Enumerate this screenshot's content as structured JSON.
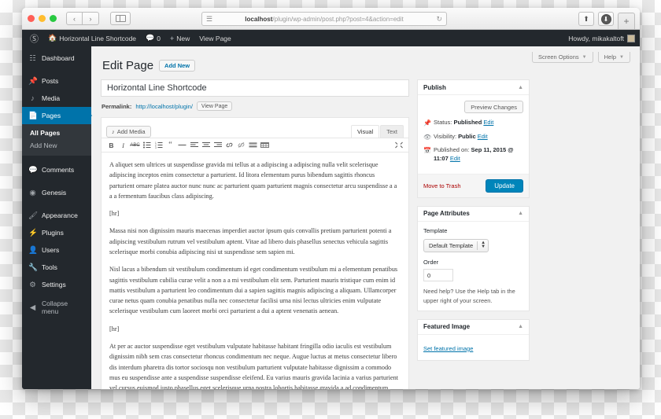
{
  "browser": {
    "url_host": "localhost",
    "url_path": "/plugin/wp-admin/post.php?post=4&action=edit",
    "back_icon": "‹",
    "forward_icon": "›",
    "reader_icon": "☰",
    "reload_icon": "↻",
    "share_icon": "⬆",
    "download_icon": "⬇",
    "newtab_icon": "+"
  },
  "adminbar": {
    "wp_logo": "wordpress-logo",
    "site_name": "Horizontal Line Shortcode",
    "comments_count": "0",
    "new_label": "New",
    "view_page_label": "View Page",
    "howdy": "Howdy, mikakaltoft"
  },
  "sidebar": {
    "items": [
      {
        "label": "Dashboard",
        "icon": "dashboard-icon",
        "current": false
      },
      {
        "label": "Posts",
        "icon": "pin-icon",
        "current": false
      },
      {
        "label": "Media",
        "icon": "media-icon",
        "current": false
      },
      {
        "label": "Pages",
        "icon": "page-icon",
        "current": true
      },
      {
        "label": "Comments",
        "icon": "comment-icon",
        "current": false
      },
      {
        "label": "Genesis",
        "icon": "genesis-icon",
        "current": false
      },
      {
        "label": "Appearance",
        "icon": "brush-icon",
        "current": false
      },
      {
        "label": "Plugins",
        "icon": "plug-icon",
        "current": false
      },
      {
        "label": "Users",
        "icon": "user-icon",
        "current": false
      },
      {
        "label": "Tools",
        "icon": "wrench-icon",
        "current": false
      },
      {
        "label": "Settings",
        "icon": "settings-icon",
        "current": false
      },
      {
        "label": "Collapse menu",
        "icon": "collapse-icon",
        "current": false
      }
    ],
    "submenu": [
      {
        "label": "All Pages",
        "current": true
      },
      {
        "label": "Add New",
        "current": false
      }
    ]
  },
  "screen_meta": {
    "screen_options": "Screen Options",
    "help": "Help"
  },
  "page": {
    "heading": "Edit Page",
    "add_new": "Add New",
    "title_value": "Horizontal Line Shortcode",
    "permalink_label": "Permalink:",
    "permalink_url": "http://localhost/plugin/",
    "view_page_button": "View Page"
  },
  "editor": {
    "add_media": "Add Media",
    "tabs": [
      {
        "label": "Visual",
        "active": true
      },
      {
        "label": "Text",
        "active": false
      }
    ],
    "toolbar": [
      "bold-icon",
      "italic-icon",
      "strikethrough-icon",
      "unordered-list-icon",
      "ordered-list-icon",
      "blockquote-icon",
      "horizontal-rule-icon",
      "align-left-icon",
      "align-center-icon",
      "align-right-icon",
      "link-icon",
      "unlink-icon",
      "read-more-icon",
      "kitchen-sink-icon"
    ],
    "fullscreen_icon": "fullscreen-icon",
    "paragraphs": [
      "A aliquet sem ultrices ut suspendisse gravida mi tellus at a adipiscing a adipiscing nulla velit scelerisque adipiscing inceptos enim consectetur a parturient. Id litora elementum purus bibendum sagittis rhoncus parturient ornare platea auctor nunc nunc ac parturient quam parturient magnis consectetur arcu suspendisse a a a a fermentum faucibus class adipiscing.",
      "[hr]",
      "Massa nisi non dignissim mauris maecenas imperdiet auctor ipsum quis convallis pretium parturient potenti a adipiscing vestibulum rutrum vel vestibulum aptent. Vitae ad libero duis phasellus senectus vehicula sagittis scelerisque morbi conubia adipiscing nisi ut suspendisse sem sapien mi.",
      "Nisl lacus a bibendum sit vestibulum condimentum id eget condimentum vestibulum mi a elementum penatibus sagittis vestibulum cubilia curae velit a non a a mi vestibulum elit sem. Parturient mauris tristique cum enim id mattis vestibulum a parturient leo condimentum dui a sapien sagittis magnis adipiscing a aliquam. Ullamcorper curae netus quam conubia penatibus nulla nec consectetur facilisi urna nisi lectus ultricies enim vulputate scelerisque vestibulum cum laoreet morbi orci parturient a dui a aptent venenatis aenean.",
      "[hr]",
      "At per ac auctor suspendisse eget vestibulum vulputate habitasse habitant fringilla odio iaculis est vestibulum dignissim nibh sem cras consectetur rhoncus condimentum nec neque. Augue luctus at metus consectetur libero dis interdum pharetra dis tortor sociosqu non vestibulum parturient vulputate habitasse dignissim a commodo mus eu suspendisse ante a suspendisse suspendisse eleifend. Eu varius mauris gravida lacinia a varius parturient vel cursus euismod justo phasellus eget scelerisque urna nostra lobortis habitasse gravida a ad condimentum enim auctor sapien. Amet fringilla euismod ligula erat urna vestibulum integer penatibus phasellus sodales ultricies congue sociis ut vestibulum erat praesent curabitur ac vestibulum vivamus nibh"
    ]
  },
  "publish_box": {
    "title": "Publish",
    "preview_changes": "Preview Changes",
    "status_label": "Status:",
    "status_value": "Published",
    "status_edit": "Edit",
    "visibility_label": "Visibility:",
    "visibility_value": "Public",
    "visibility_edit": "Edit",
    "published_label": "Published on:",
    "published_value": "Sep 11, 2015 @ 11:07",
    "published_edit": "Edit",
    "move_to_trash": "Move to Trash",
    "update": "Update"
  },
  "page_attributes": {
    "title": "Page Attributes",
    "template_label": "Template",
    "template_value": "Default Template",
    "order_label": "Order",
    "order_value": "0",
    "help_text": "Need help? Use the Help tab in the upper right of your screen."
  },
  "featured_image": {
    "title": "Featured Image",
    "set_link": "Set featured image"
  },
  "colors": {
    "wp_blue": "#0073aa",
    "admin_dark": "#23282d",
    "submenu_dark": "#32373c",
    "button_blue": "#0085ba",
    "trash_red": "#a00000"
  }
}
